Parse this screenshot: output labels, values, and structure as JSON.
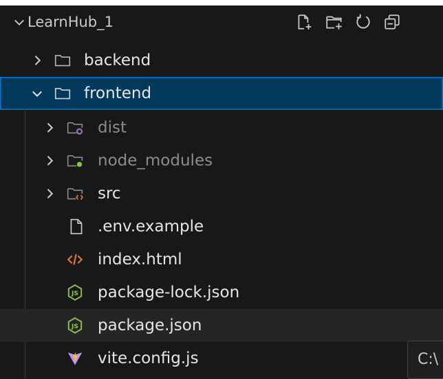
{
  "explorer": {
    "root_label": "LearnHub_1",
    "actions": [
      {
        "name": "new-file-icon"
      },
      {
        "name": "new-folder-icon"
      },
      {
        "name": "refresh-icon"
      },
      {
        "name": "collapse-all-icon"
      }
    ]
  },
  "tree": {
    "backend": "backend",
    "frontend": "frontend",
    "dist": "dist",
    "node_modules": "node_modules",
    "src": "src",
    "env_example": ".env.example",
    "index_html": "index.html",
    "package_lock": "package-lock.json",
    "package_json": "package.json",
    "vite_config": "vite.config.js"
  },
  "tooltip": {
    "text": "C:\\"
  },
  "colors": {
    "selected_bg": "#04395e",
    "focus_border": "#0078d4",
    "html_icon": "#e37933",
    "json_icon": "#8dc149",
    "vite_icon": "#bd93f9",
    "dist_badge": "#a074c4",
    "node_badge": "#8dc149",
    "src_badge": "#e37933"
  }
}
